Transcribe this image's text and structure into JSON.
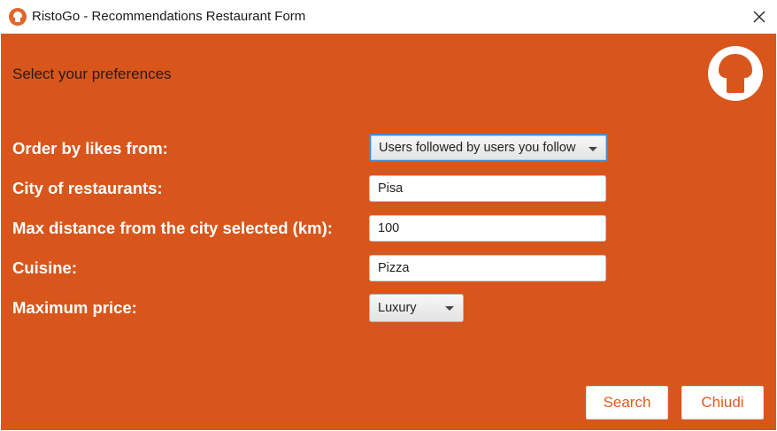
{
  "window": {
    "title": "RistoGo - Recommendations Restaurant Form",
    "app_icon": "chef-hat-icon",
    "close_icon": "close-icon"
  },
  "header": {
    "subtitle": "Select your preferences",
    "logo_icon": "chef-hat-logo"
  },
  "form": {
    "order_by": {
      "label": "Order by likes from:",
      "value": "Users followed by users you follow"
    },
    "city": {
      "label": "City of restaurants:",
      "value": "Pisa"
    },
    "max_distance": {
      "label": "Max distance from the city selected (km):",
      "value": "100"
    },
    "cuisine": {
      "label": "Cuisine:",
      "value": "Pizza"
    },
    "max_price": {
      "label": "Maximum price:",
      "value": "Luxury"
    }
  },
  "buttons": {
    "search": "Search",
    "close": "Chiudi"
  },
  "colors": {
    "background": "#d8561c",
    "button_text": "#e15a1f",
    "focus": "#3a8ed8"
  }
}
